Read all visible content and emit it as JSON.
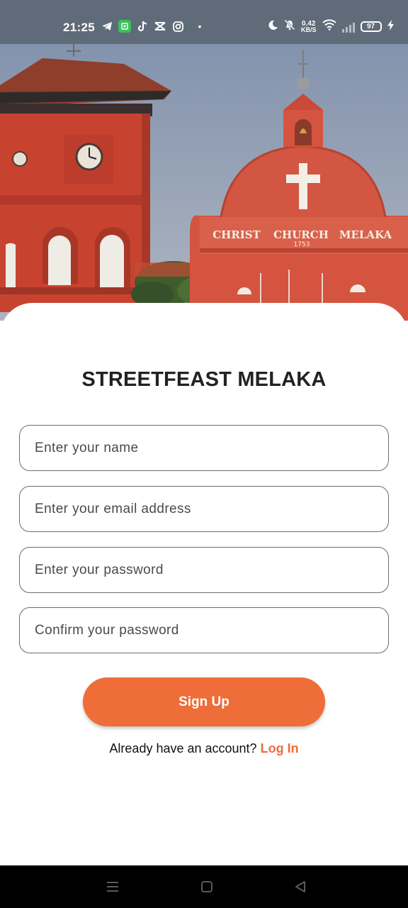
{
  "status_bar": {
    "time": "21:25",
    "net_speed_value": "0.42",
    "net_speed_unit": "KB/S",
    "battery": "97",
    "icons_left": [
      "telegram-icon",
      "green-app-icon",
      "tiktok-icon",
      "capcut-icon",
      "instagram-icon",
      "more-dot-icon"
    ],
    "icons_right": [
      "moon-icon",
      "bell-muted-icon",
      "wifi-icon",
      "signal-icon",
      "battery-icon",
      "charging-icon"
    ]
  },
  "hero": {
    "sign_words": [
      "CHRIST",
      "CHURCH",
      "MELAKA"
    ],
    "year": "1753",
    "colors": {
      "sky": "#8e9cb4",
      "building": "#d4533f",
      "building_dark": "#b8402f",
      "roof": "#8b3d2a"
    }
  },
  "signup_form": {
    "title": "STREETFEAST MELAKA",
    "name_placeholder": "Enter your name",
    "email_placeholder": "Enter your email address",
    "password_placeholder": "Enter your password",
    "confirm_placeholder": "Confirm your password",
    "submit_label": "Sign Up",
    "login_prompt": "Already have an account?",
    "login_link": "Log In"
  },
  "theme": {
    "accent": "#ee6d38",
    "title_color": "#222222",
    "field_border": "#6b6b6b"
  },
  "nav_bar": {
    "buttons": [
      "menu-icon",
      "home-square-icon",
      "back-triangle-icon"
    ]
  }
}
